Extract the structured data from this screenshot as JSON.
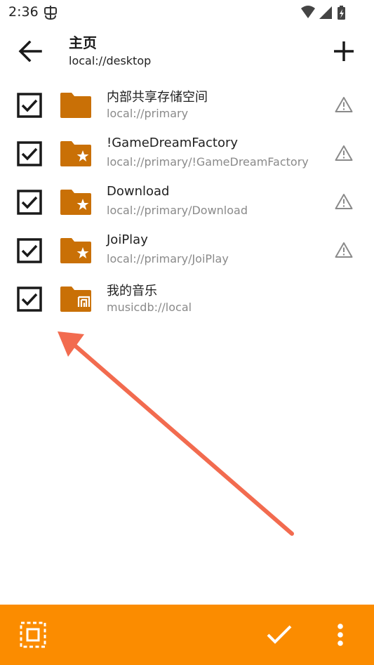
{
  "status_bar": {
    "time": "2:36",
    "notification_icon": "bug-icon",
    "wifi_icon": "wifi-icon",
    "signal_icon": "cell-signal-icon",
    "battery_icon": "battery-charging-icon"
  },
  "app_bar": {
    "title": "主页",
    "subtitle": "local://desktop",
    "back_icon": "arrow-left-icon",
    "add_icon": "plus-icon"
  },
  "items": [
    {
      "name": "内部共享存储空间",
      "path": "local://primary",
      "checked": true,
      "folder_icon": "folder-icon",
      "warning": true
    },
    {
      "name": "!GameDreamFactory",
      "path": "local://primary/!GameDreamFactory",
      "checked": true,
      "folder_icon": "star-folder-icon",
      "warning": true
    },
    {
      "name": "Download",
      "path": "local://primary/Download",
      "checked": true,
      "folder_icon": "star-folder-icon",
      "warning": true
    },
    {
      "name": "JoiPlay",
      "path": "local://primary/JoiPlay",
      "checked": true,
      "folder_icon": "star-folder-icon",
      "warning": true
    },
    {
      "name": "我的音乐",
      "path": "musicdb://local",
      "checked": true,
      "folder_icon": "music-folder-icon",
      "warning": false
    }
  ],
  "bottom_bar": {
    "select_icon": "select-all-icon",
    "confirm_icon": "check-icon",
    "more_icon": "more-vertical-icon"
  },
  "colors": {
    "accent": "#fb8c00",
    "folder": "#c97006",
    "annotation_arrow": "#f26b4f"
  }
}
